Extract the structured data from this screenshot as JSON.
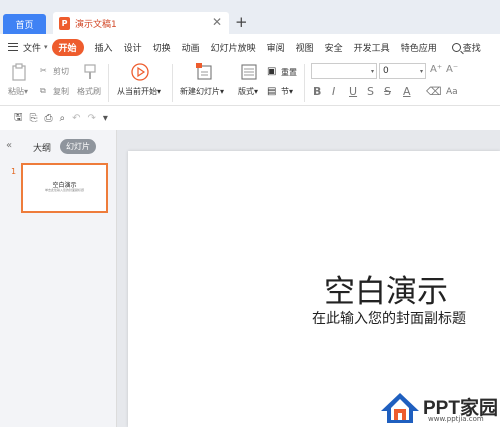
{
  "tabs": {
    "home_label": "首页",
    "doc_icon_glyph": "P",
    "doc_label": "演示文稿1",
    "close_glyph": "✕",
    "add_glyph": "+"
  },
  "menu": {
    "file_label": "文件",
    "file_caret": "▾",
    "active_label": "开始",
    "items": [
      "插入",
      "设计",
      "切换",
      "动画",
      "幻灯片放映",
      "审阅",
      "视图",
      "安全",
      "开发工具",
      "特色应用"
    ],
    "search_label": "查找"
  },
  "ribbon": {
    "paste_label": "粘贴",
    "paste_dd": "▾",
    "cut_label": "剪切",
    "copy_label": "复制",
    "format_painter_label": "格式刷",
    "from_current_label": "从当前开始",
    "from_current_dd": "▾",
    "new_slide_label": "新建幻灯片",
    "new_slide_dd": "▾",
    "layout_label": "版式",
    "layout_dd": "▾",
    "reset_label": "重置",
    "section_label": "节",
    "section_dd": "▾",
    "font_name_value": "",
    "font_size_value": "0",
    "bold_glyph": "B",
    "italic_glyph": "I",
    "underline_glyph": "U",
    "strike_glyph": "S",
    "font_color_glyph": "A",
    "accent_color": "#ee5c2d"
  },
  "quick_access": {
    "save_glyph": "🖫",
    "undo_glyph": "↶",
    "redo_glyph": "↷",
    "more_glyph": "▾"
  },
  "sidebar": {
    "collapse_glyph": "«",
    "outline_tab": "大纲",
    "slides_tab": "幻灯片",
    "slide_number": "1",
    "thumb_title": "空白演示",
    "thumb_subtitle": "单击此处输入您的封面副标题"
  },
  "slide": {
    "title": "空白演示",
    "subtitle": "在此输入您的封面副标题"
  },
  "watermark": {
    "text": "PPT家园",
    "url": "www.pptjia.com"
  }
}
